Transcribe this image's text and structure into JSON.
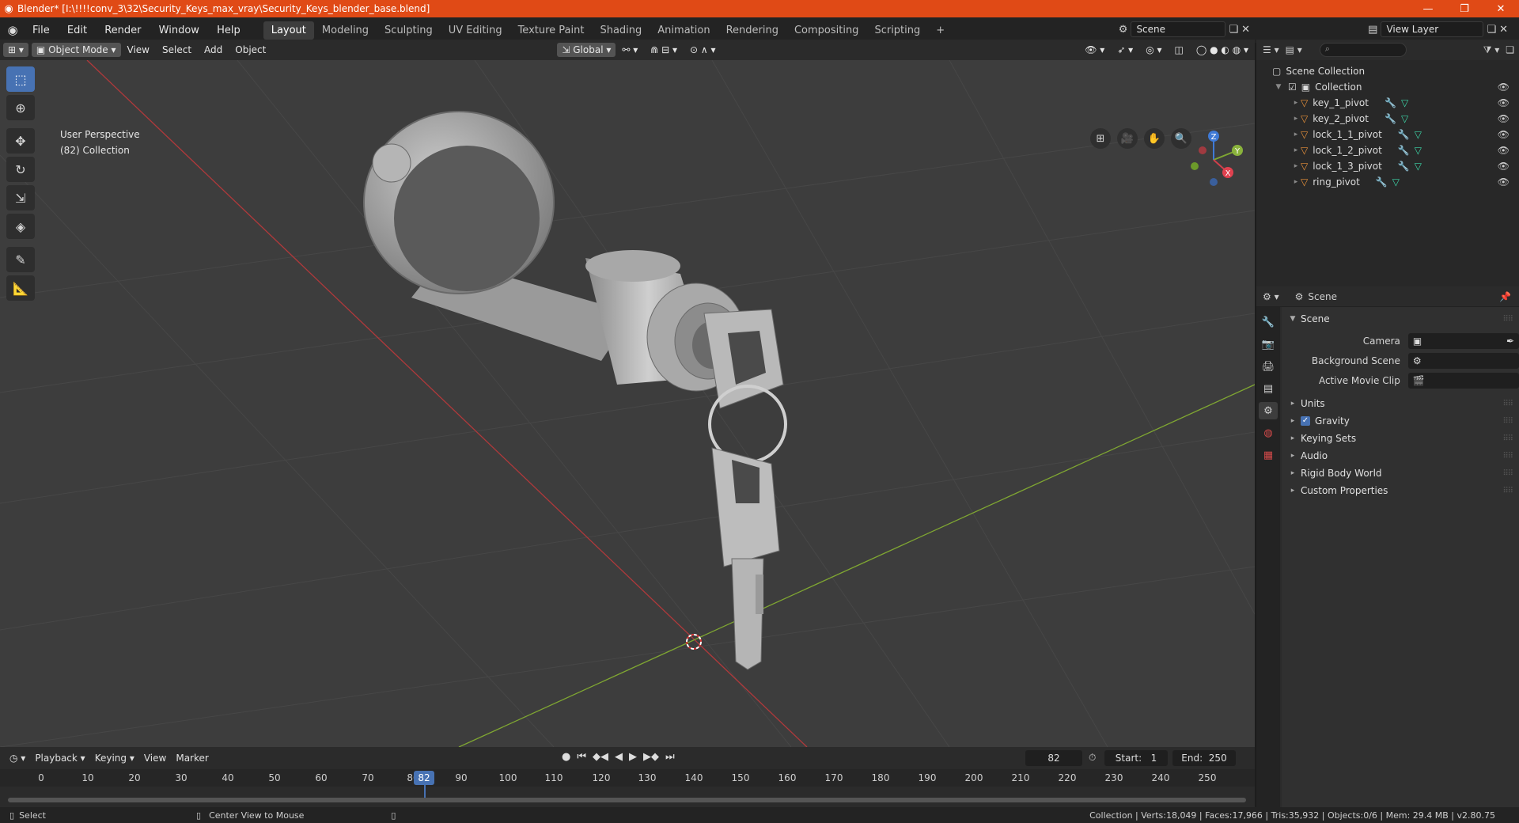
{
  "window": {
    "title": "Blender* [I:\\!!!!conv_3\\32\\Security_Keys_max_vray\\Security_Keys_blender_base.blend]",
    "controls": {
      "minimize": "—",
      "maximize": "❐",
      "close": "✕"
    }
  },
  "menu": [
    "File",
    "Edit",
    "Render",
    "Window",
    "Help"
  ],
  "workspaces": [
    "Layout",
    "Modeling",
    "Sculpting",
    "UV Editing",
    "Texture Paint",
    "Shading",
    "Animation",
    "Rendering",
    "Compositing",
    "Scripting"
  ],
  "active_workspace": "Layout",
  "add_workspace": "+",
  "scene_name": "Scene",
  "view_layer": "View Layer",
  "viewport_header": {
    "mode": "Object Mode",
    "menus": [
      "View",
      "Select",
      "Add",
      "Object"
    ],
    "transform_orientation": "Global"
  },
  "viewport": {
    "perspective_label": "User Perspective",
    "collection_label": "(82) Collection",
    "gizmo": {
      "x": "X",
      "y": "Y",
      "z": "Z"
    }
  },
  "outliner": {
    "root": "Scene Collection",
    "collection": "Collection",
    "items": [
      "key_1_pivot",
      "key_2_pivot",
      "lock_1_1_pivot",
      "lock_1_2_pivot",
      "lock_1_3_pivot",
      "ring_pivot"
    ]
  },
  "properties": {
    "header": "Scene",
    "section": "Scene",
    "fields": [
      {
        "label": "Camera",
        "value": ""
      },
      {
        "label": "Background Scene",
        "value": ""
      },
      {
        "label": "Active Movie Clip",
        "value": ""
      }
    ],
    "subsections": [
      "Units",
      "Gravity",
      "Keying Sets",
      "Audio",
      "Rigid Body World",
      "Custom Properties"
    ],
    "gravity_checked": true
  },
  "timeline": {
    "menus": [
      "Playback",
      "Keying",
      "View",
      "Marker"
    ],
    "current_frame": "82",
    "start_label": "Start:",
    "start": "1",
    "end_label": "End:",
    "end": "250",
    "ticks": [
      "0",
      "10",
      "20",
      "30",
      "40",
      "50",
      "60",
      "70",
      "80",
      "90",
      "100",
      "110",
      "120",
      "130",
      "140",
      "150",
      "160",
      "170",
      "180",
      "190",
      "200",
      "210",
      "220",
      "230",
      "240",
      "250"
    ]
  },
  "statusbar": {
    "left": "Select",
    "middle": "Center View to Mouse",
    "right": "Collection | Verts:18,049 | Faces:17,966 | Tris:35,932 | Objects:0/6 | Mem: 29.4 MB | v2.80.75"
  },
  "colors": {
    "title_bar": "#e04a16",
    "accent": "#4772b3",
    "x_axis": "#c0392b",
    "y_axis": "#7fa632"
  }
}
